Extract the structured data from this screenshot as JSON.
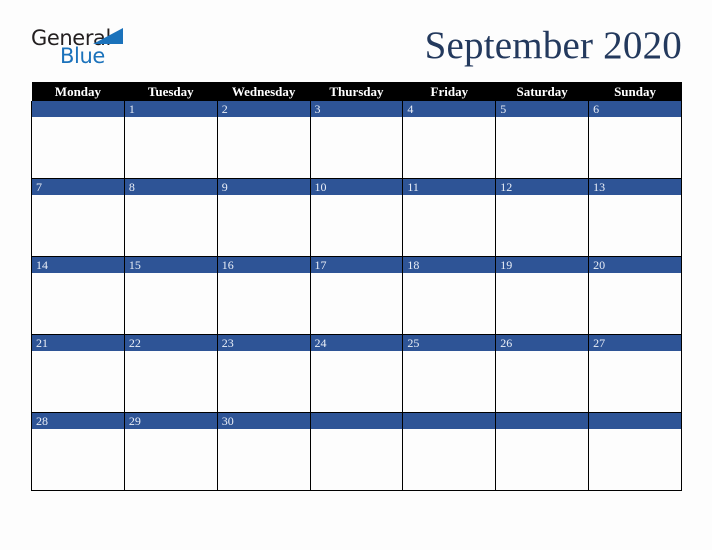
{
  "brand": {
    "name_top": "General",
    "name_bottom": "Blue",
    "top_color": "#231f20",
    "bottom_color": "#1b72bb",
    "triangle_color": "#1b72bb"
  },
  "title": "September 2020",
  "title_color": "#23395d",
  "colors": {
    "header_background": "#000000",
    "header_text": "#ffffff",
    "date_bar": "#2e5496",
    "date_text": "#e9eef7",
    "cell_background": "#fdfdfd",
    "grid_line": "#000000",
    "page_background": "#fdfdfd"
  },
  "weekday_headers": [
    "Monday",
    "Tuesday",
    "Wednesday",
    "Thursday",
    "Friday",
    "Saturday",
    "Sunday"
  ],
  "weeks": [
    {
      "days": [
        "",
        "1",
        "2",
        "3",
        "4",
        "5",
        "6"
      ]
    },
    {
      "days": [
        "7",
        "8",
        "9",
        "10",
        "11",
        "12",
        "13"
      ]
    },
    {
      "days": [
        "14",
        "15",
        "16",
        "17",
        "18",
        "19",
        "20"
      ]
    },
    {
      "days": [
        "21",
        "22",
        "23",
        "24",
        "25",
        "26",
        "27"
      ]
    },
    {
      "days": [
        "28",
        "29",
        "30",
        "",
        "",
        "",
        ""
      ]
    }
  ]
}
